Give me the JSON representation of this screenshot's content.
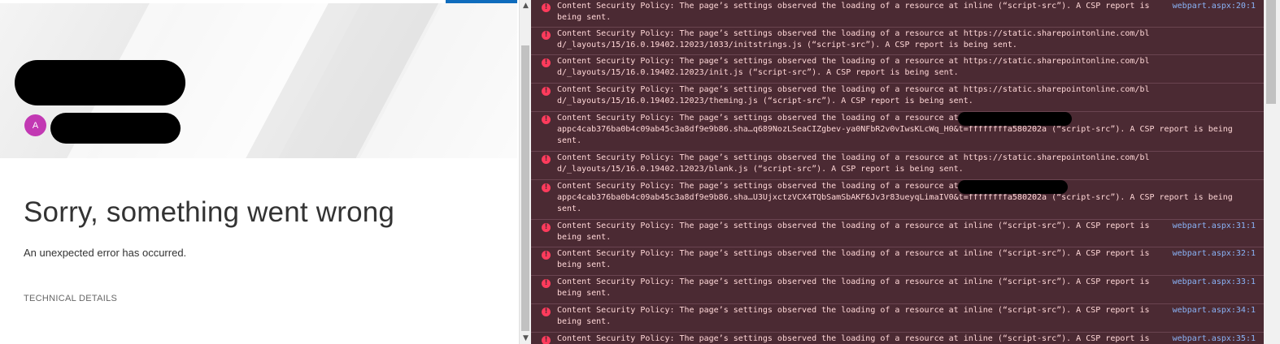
{
  "left_pane": {
    "avatar_initial": "A",
    "error_title": "Sorry, something went wrong",
    "error_message": "An unexpected error has occurred.",
    "technical_details_label": "TECHNICAL DETAILS",
    "avatar_color": "#c239b3"
  },
  "console": {
    "entries": [
      {
        "text": "Content Security Policy: The page’s settings observed the loading of a resource at inline (“script-src”). A CSP report is being sent.",
        "source": "webpart.aspx:20:1"
      },
      {
        "text": "Content Security Policy: The page’s settings observed the loading of a resource at https://static.sharepointonline.com/bld/_layouts/15/16.0.19402.12023/1033/initstrings.js (“script-src”). A CSP report is being sent.",
        "source": ""
      },
      {
        "text": "Content Security Policy: The page’s settings observed the loading of a resource at https://static.sharepointonline.com/bld/_layouts/15/16.0.19402.12023/init.js (“script-src”). A CSP report is being sent.",
        "source": ""
      },
      {
        "text": "Content Security Policy: The page’s settings observed the loading of a resource at https://static.sharepointonline.com/bld/_layouts/15/16.0.19402.12023/theming.js (“script-src”). A CSP report is being sent.",
        "source": ""
      },
      {
        "text": "Content Security Policy: The page’s settings observed the loading of a resource at\nappc4cab376ba0b4c09ab45c3a8df9e9b86.sha…q689NozLSeaCIZgbev-ya0NFbR2v0vIwsKLcWq_H0&t=ffffffffa580202a (“script-src”). A CSP report is being sent.",
        "source": ""
      },
      {
        "text": "Content Security Policy: The page’s settings observed the loading of a resource at https://static.sharepointonline.com/bld/_layouts/15/16.0.19402.12023/blank.js (“script-src”). A CSP report is being sent.",
        "source": ""
      },
      {
        "text": "Content Security Policy: The page’s settings observed the loading of a resource at\nappc4cab376ba0b4c09ab45c3a8df9e9b86.sha…U3UjxctzVCX4TQbSamSbAKF6Jv3r83ueyqLimaIV0&t=ffffffffa580202a (“script-src”). A CSP report is being sent.",
        "source": ""
      },
      {
        "text": "Content Security Policy: The page’s settings observed the loading of a resource at inline (“script-src”). A CSP report is being sent.",
        "source": "webpart.aspx:31:1"
      },
      {
        "text": "Content Security Policy: The page’s settings observed the loading of a resource at inline (“script-src”). A CSP report is being sent.",
        "source": "webpart.aspx:32:1"
      },
      {
        "text": "Content Security Policy: The page’s settings observed the loading of a resource at inline (“script-src”). A CSP report is being sent.",
        "source": "webpart.aspx:33:1"
      },
      {
        "text": "Content Security Policy: The page’s settings observed the loading of a resource at inline (“script-src”). A CSP report is being sent.",
        "source": "webpart.aspx:34:1"
      },
      {
        "text": "Content Security Policy: The page’s settings observed the loading of a resource at inline (“script-src”). A CSP report is being sent.",
        "source": "webpart.aspx:35:1"
      }
    ],
    "error_icon_glyph": "!",
    "colors": {
      "background": "#4b2a33",
      "text": "#ffd7d7",
      "source_link": "#8ab4f8",
      "icon": "#ff3b5c"
    }
  }
}
